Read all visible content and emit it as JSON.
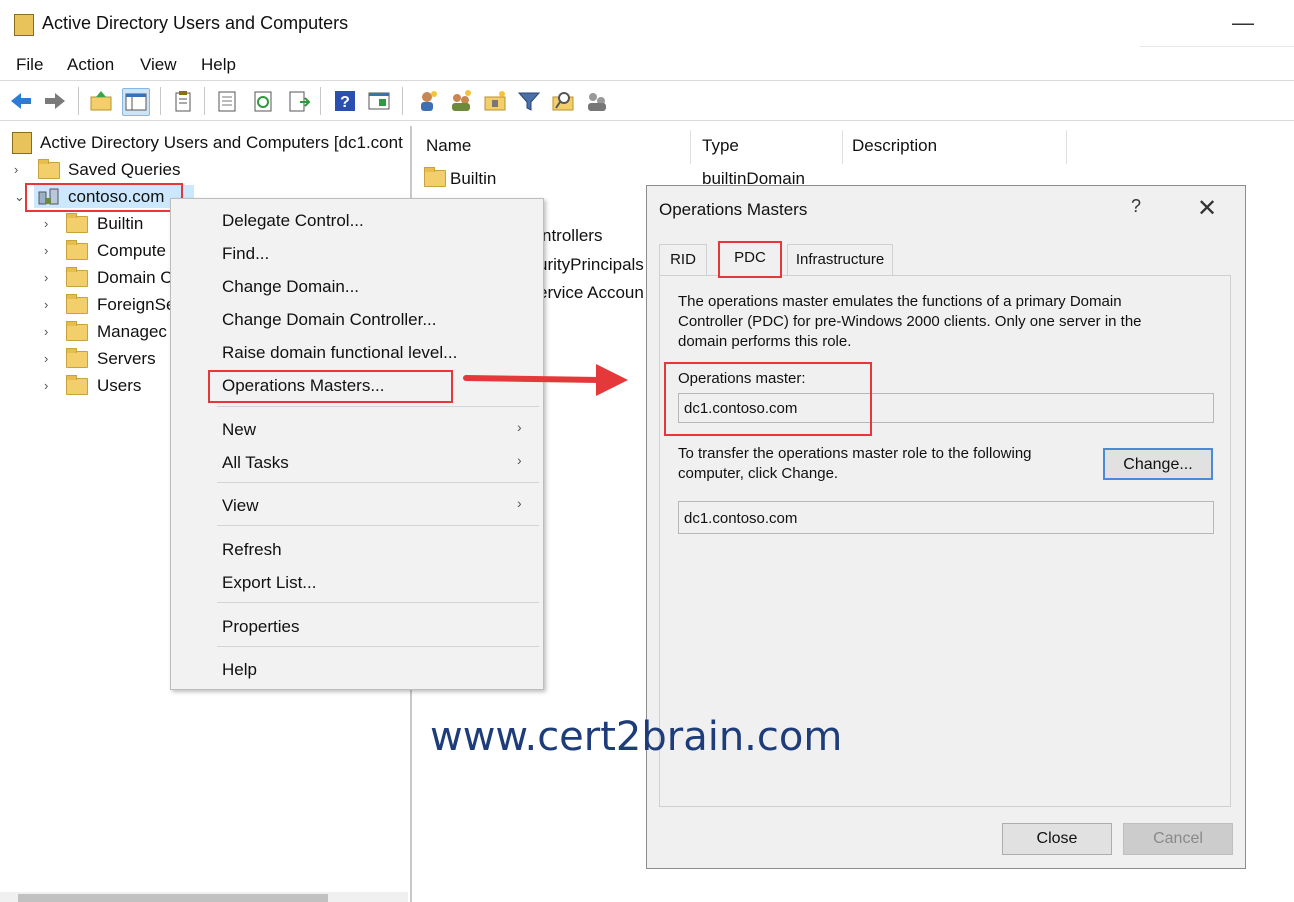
{
  "window": {
    "title": "Active Directory Users and Computers",
    "minimize_glyph": "—"
  },
  "menu": [
    "File",
    "Action",
    "View",
    "Help"
  ],
  "toolbar": {
    "icons": [
      "back-icon",
      "forward-icon",
      "up-folder-icon",
      "show-tree-icon",
      "clipboard-icon",
      "properties-icon",
      "refresh-icon",
      "export-icon",
      "help-icon",
      "console-icon",
      "new-user-icon",
      "new-group-icon",
      "new-ou-icon",
      "filter-icon",
      "find-icon",
      "delegate-icon"
    ]
  },
  "tree": {
    "root": "Active Directory Users and Computers [dc1.cont",
    "saved_queries": "Saved Queries",
    "domain": "contoso.com",
    "children": [
      "Builtin",
      "Compute",
      "Domain C",
      "ForeignSe",
      "Managec",
      "Servers",
      "Users"
    ]
  },
  "list": {
    "columns": {
      "name": "Name",
      "type": "Type",
      "description": "Description"
    },
    "rows": [
      {
        "name": "Builtin",
        "type": "builtinDomain"
      },
      {
        "name": "ntrollers"
      },
      {
        "name": "urityPrincipals"
      },
      {
        "name": "ervice Accoun"
      }
    ]
  },
  "context_menu": {
    "delegate": "Delegate Control...",
    "find": "Find...",
    "change_domain": "Change Domain...",
    "change_dc": "Change Domain Controller...",
    "raise": "Raise domain functional level...",
    "ops_masters": "Operations Masters...",
    "new": "New",
    "all_tasks": "All Tasks",
    "view": "View",
    "refresh": "Refresh",
    "export": "Export List...",
    "properties": "Properties",
    "help": "Help",
    "submenu_arrow": "›"
  },
  "dialog": {
    "title": "Operations Masters",
    "help_glyph": "?",
    "close_glyph": "✕",
    "tabs": [
      "RID",
      "PDC",
      "Infrastructure"
    ],
    "active_tab": "PDC",
    "description": "The operations master emulates the functions of a primary Domain Controller (PDC) for pre-Windows 2000 clients. Only one server in the domain performs this role.",
    "ops_master_label": "Operations master:",
    "ops_master_value": "dc1.contoso.com",
    "transfer_text": "To transfer the operations master role to the following computer, click Change.",
    "change_button": "Change...",
    "target_value": "dc1.contoso.com",
    "close_button": "Close",
    "cancel_button": "Cancel"
  },
  "watermark": "www.cert2brain.com",
  "colors": {
    "highlight": "#e5383b",
    "accent": "#4a8ad6",
    "watermark": "#1f3c7a"
  }
}
